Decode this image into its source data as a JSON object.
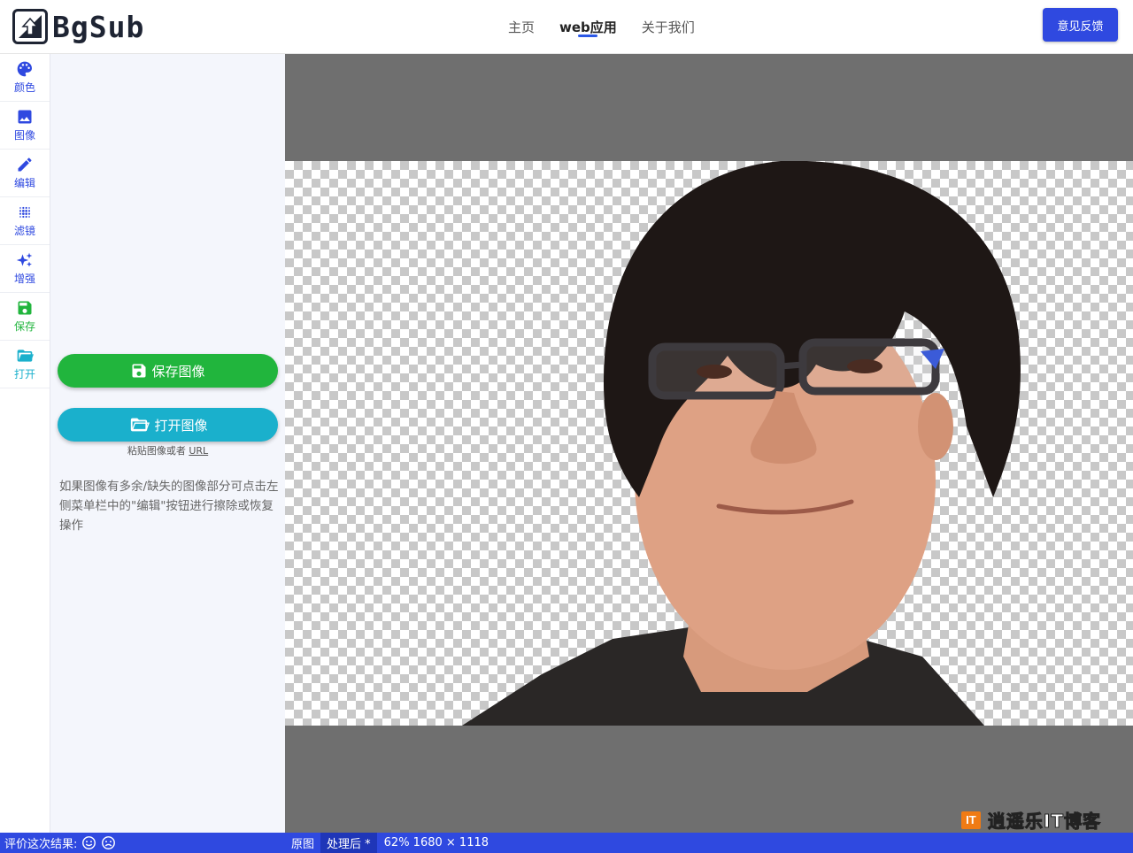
{
  "brand": {
    "name": "BgSub"
  },
  "nav": [
    {
      "label": "主页",
      "active": false
    },
    {
      "label": "web应用",
      "active": true
    },
    {
      "label": "关于我们",
      "active": false
    }
  ],
  "header": {
    "feedback_label": "意见反馈"
  },
  "rail": [
    {
      "label": "颜色",
      "icon": "palette-icon"
    },
    {
      "label": "图像",
      "icon": "image-icon"
    },
    {
      "label": "编辑",
      "icon": "pencil-icon"
    },
    {
      "label": "滤镜",
      "icon": "blur-icon"
    },
    {
      "label": "增强",
      "icon": "sparkle-icon"
    },
    {
      "label": "保存",
      "icon": "floppy-icon"
    },
    {
      "label": "打开",
      "icon": "folder-open-icon"
    }
  ],
  "panel": {
    "save_label": "保存图像",
    "open_label": "打开图像",
    "paste_text": "粘贴图像或者",
    "paste_url": "URL",
    "tip": "如果图像有多余/缺失的图像部分可点击左侧菜单栏中的\"编辑\"按钮进行擦除或恢复操作"
  },
  "watermark": {
    "icon_text": "IT",
    "text": "逍遥乐IT博客"
  },
  "status": {
    "rate_label": "评价这次结果:",
    "tab_original": "原图",
    "tab_processed": "处理后 *",
    "zoom_info": "62% 1680 × 1118"
  },
  "colors": {
    "accent": "#2f49e0",
    "save": "#21b53d",
    "open": "#1ab0cc",
    "canvas_bg": "#6f6f6f"
  }
}
